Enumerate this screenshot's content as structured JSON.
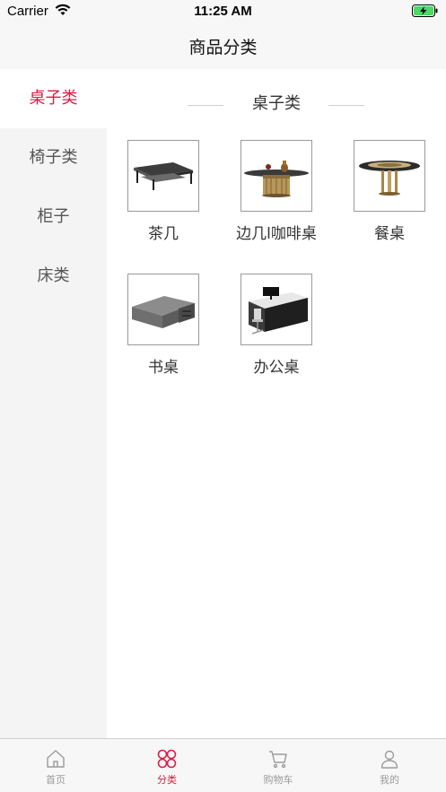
{
  "status_bar": {
    "carrier": "Carrier",
    "time": "11:25 AM",
    "wifi_icon": "wifi-icon",
    "battery_icon": "battery-charging-icon"
  },
  "nav": {
    "title": "商品分类"
  },
  "sidebar": {
    "items": [
      {
        "label": "桌子类",
        "active": true
      },
      {
        "label": "椅子类",
        "active": false
      },
      {
        "label": "柜子",
        "active": false
      },
      {
        "label": "床类",
        "active": false
      }
    ]
  },
  "section": {
    "title": "桌子类"
  },
  "products": [
    {
      "name": "茶几",
      "icon": "coffee-table-image"
    },
    {
      "name": "边几l咖啡桌",
      "icon": "side-table-image"
    },
    {
      "name": "餐桌",
      "icon": "dining-table-image"
    },
    {
      "name": "书桌",
      "icon": "desk-image"
    },
    {
      "name": "办公桌",
      "icon": "office-desk-image"
    }
  ],
  "tabs": [
    {
      "label": "首页",
      "icon": "home-icon",
      "active": false
    },
    {
      "label": "分类",
      "icon": "category-icon",
      "active": true
    },
    {
      "label": "购物车",
      "icon": "cart-icon",
      "active": false
    },
    {
      "label": "我的",
      "icon": "user-icon",
      "active": false
    }
  ],
  "colors": {
    "accent": "#d81e45",
    "tab_inactive": "#9b9b9b",
    "sidebar_bg": "#f4f4f4"
  }
}
